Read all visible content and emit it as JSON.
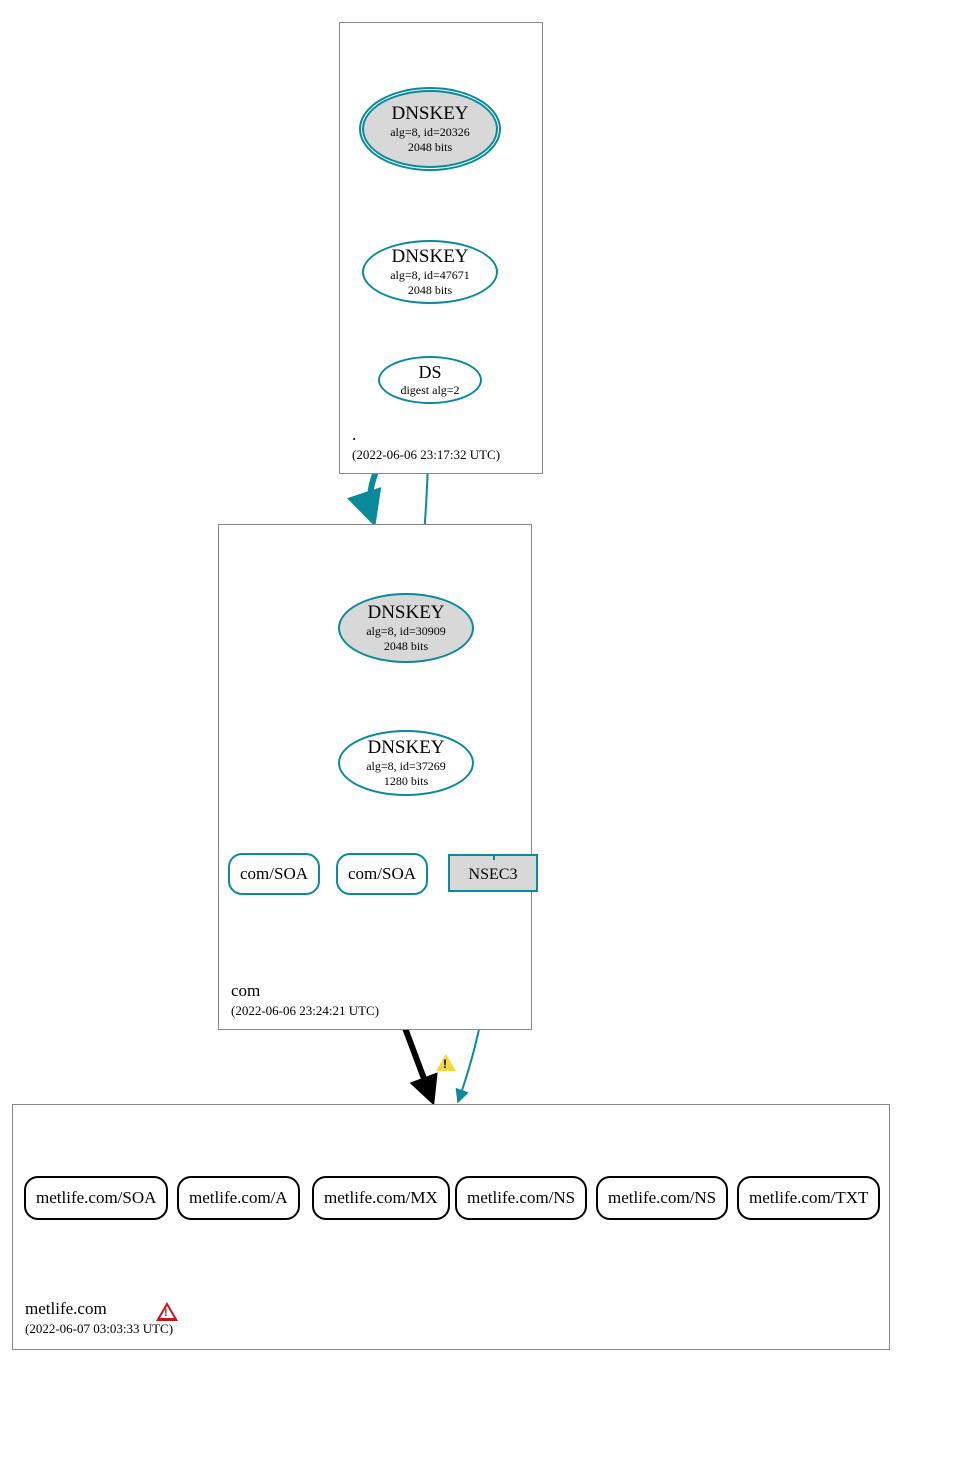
{
  "zones": {
    "root": {
      "name": ".",
      "ts": "(2022-06-06 23:17:32 UTC)"
    },
    "com": {
      "name": "com",
      "ts": "(2022-06-06 23:24:21 UTC)"
    },
    "leaf": {
      "name": "metlife.com",
      "ts": "(2022-06-07 03:03:33 UTC)"
    }
  },
  "nodes": {
    "root_ksk": {
      "l1": "DNSKEY",
      "l2": "alg=8, id=20326",
      "l3": "2048 bits"
    },
    "root_zsk": {
      "l1": "DNSKEY",
      "l2": "alg=8, id=47671",
      "l3": "2048 bits"
    },
    "root_ds": {
      "l1": "DS",
      "l2": "digest alg=2"
    },
    "com_ksk": {
      "l1": "DNSKEY",
      "l2": "alg=8, id=30909",
      "l3": "2048 bits"
    },
    "com_zsk": {
      "l1": "DNSKEY",
      "l2": "alg=8, id=37269",
      "l3": "1280 bits"
    },
    "com_soa1": "com/SOA",
    "com_soa2": "com/SOA",
    "com_nsec3": "NSEC3",
    "leaf_soa": "metlife.com/SOA",
    "leaf_a": "metlife.com/A",
    "leaf_mx": "metlife.com/MX",
    "leaf_ns1": "metlife.com/NS",
    "leaf_ns2": "metlife.com/NS",
    "leaf_txt": "metlife.com/TXT"
  },
  "colors": {
    "teal": "#0a8a9a",
    "black": "#000000"
  }
}
